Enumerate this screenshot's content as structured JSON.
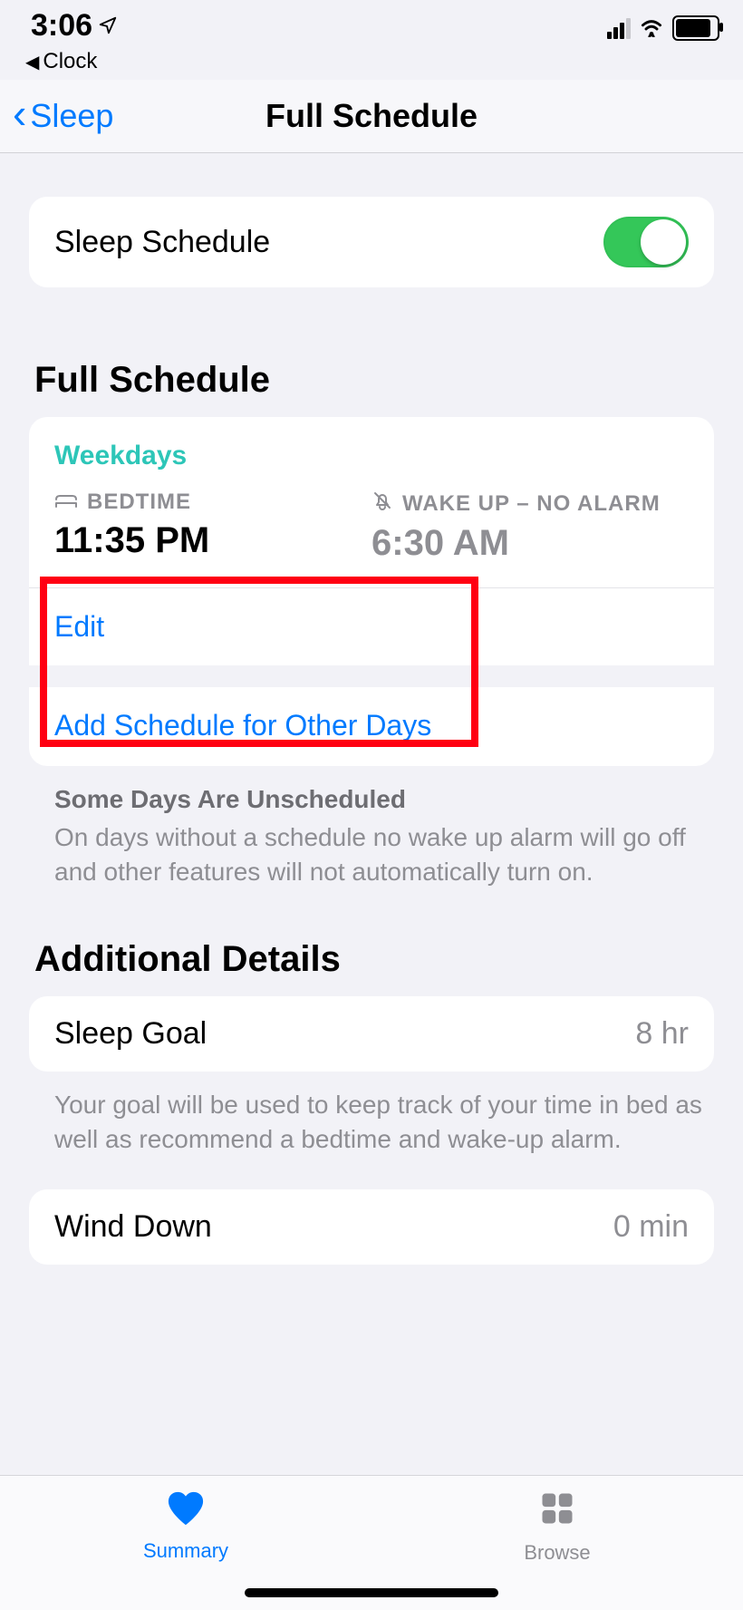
{
  "statusbar": {
    "time": "3:06",
    "breadcrumb": "Clock"
  },
  "navbar": {
    "back_label": "Sleep",
    "title": "Full Schedule"
  },
  "sleep_schedule_row": {
    "label": "Sleep Schedule"
  },
  "sections": {
    "full_schedule_title": "Full Schedule",
    "additional_details_title": "Additional Details"
  },
  "schedule": {
    "days_label": "Weekdays",
    "bedtime_head": "BEDTIME",
    "bedtime_value": "11:35 PM",
    "wakeup_head": "WAKE UP – NO ALARM",
    "wakeup_value": "6:30 AM",
    "edit_label": "Edit",
    "add_label": "Add Schedule for Other Days"
  },
  "unscheduled_note": {
    "title": "Some Days Are Unscheduled",
    "body": "On days without a schedule no wake up alarm will go off and other features will not automatically turn on."
  },
  "details": {
    "sleep_goal_label": "Sleep Goal",
    "sleep_goal_value": "8 hr",
    "sleep_goal_note": "Your goal will be used to keep track of your time in bed as well as recommend a bedtime and wake-up alarm.",
    "wind_down_label": "Wind Down",
    "wind_down_value": "0 min"
  },
  "tabbar": {
    "summary": "Summary",
    "browse": "Browse"
  }
}
